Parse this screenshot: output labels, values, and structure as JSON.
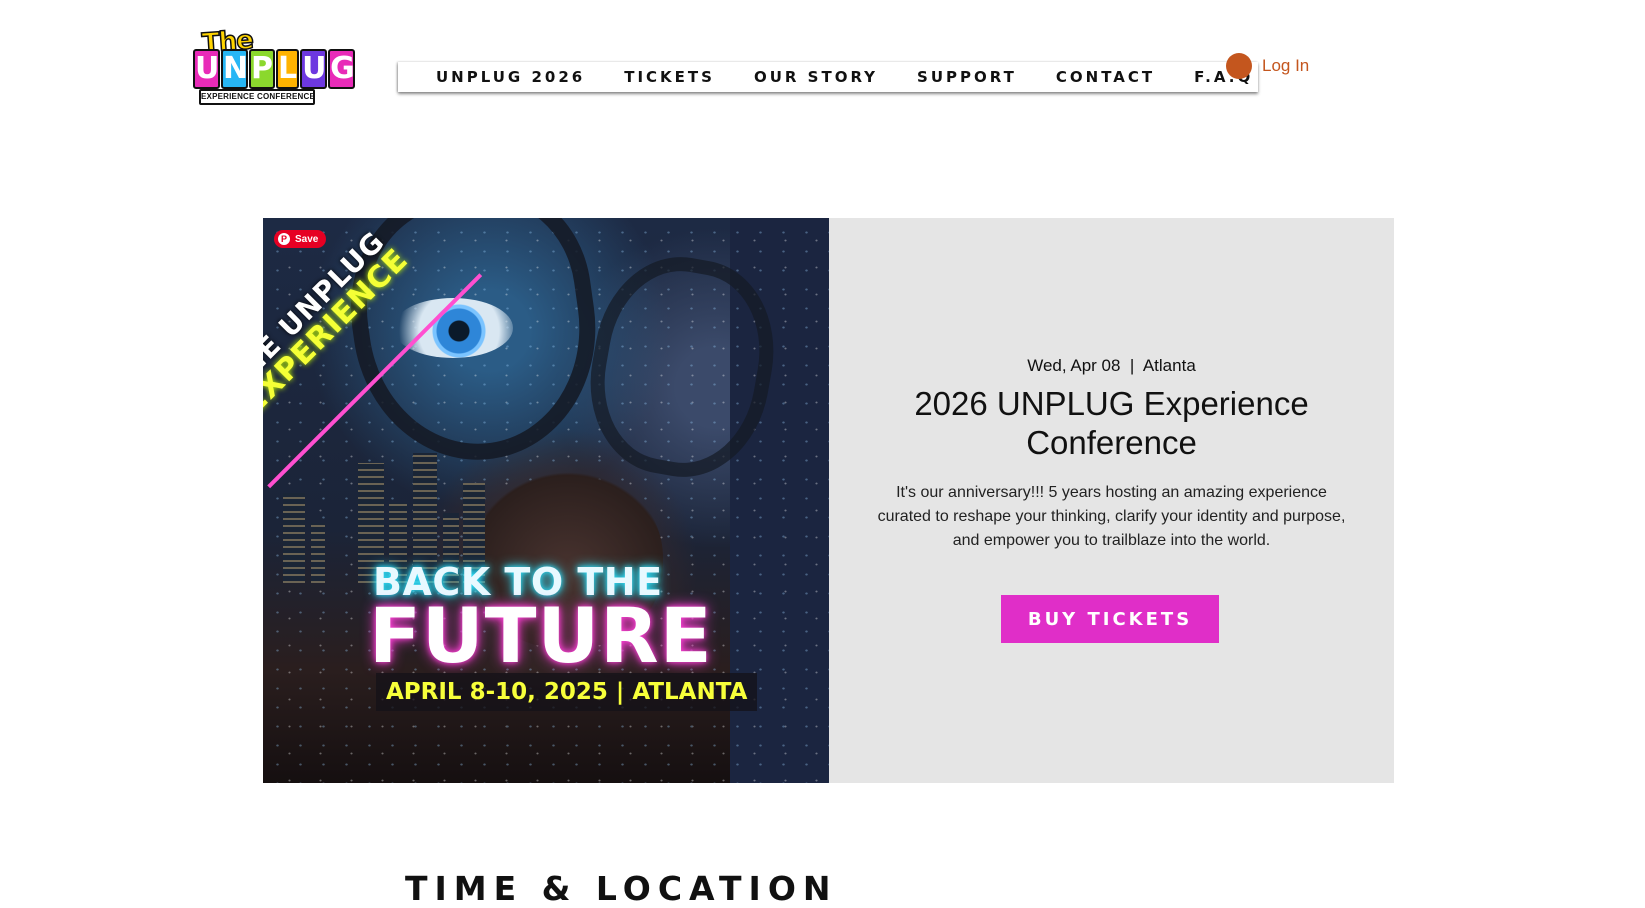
{
  "brand": {
    "logo_the": "The",
    "logo_letters": [
      "U",
      "N",
      "P",
      "L",
      "U",
      "G"
    ],
    "logo_letter_colors": [
      "#e82bb8",
      "#27b6f5",
      "#8bd82d",
      "#ffb300",
      "#6d38e0",
      "#e82bb8"
    ],
    "logo_subtitle": "EXPERIENCE CONFERENCE"
  },
  "nav": {
    "items": [
      {
        "label": "UNPLUG 2026"
      },
      {
        "label": "TICKETS"
      },
      {
        "label": "OUR STORY"
      },
      {
        "label": "SUPPORT"
      },
      {
        "label": "CONTACT"
      },
      {
        "label": "F.A.Q"
      }
    ]
  },
  "login": {
    "label": "Log In",
    "icon": "user-avatar-icon",
    "color": "#c4561e"
  },
  "poster": {
    "save_label": "Save",
    "save_icon": "pinterest-icon",
    "banner_line1": "THE UNPLUG",
    "banner_line2": "EXPERIENCE",
    "subtitle": "BACK TO THE",
    "title": "FUTURE",
    "date_location": "APRIL 8-10, 2025 | ATLANTA"
  },
  "event": {
    "date": "Wed, Apr 08",
    "separator": "|",
    "location": "Atlanta",
    "title": "2026 UNPLUG Experience Conference",
    "description": "It's our anniversary!!! 5 years hosting an amazing experience curated to reshape your thinking, clarify your identity and purpose, and empower you to trailblaze into the world.",
    "cta_label": "BUY TICKETS",
    "cta_color": "#e02ec8",
    "panel_color": "#e5e5e5"
  },
  "sections": {
    "time_location": "TIME & LOCATION"
  }
}
